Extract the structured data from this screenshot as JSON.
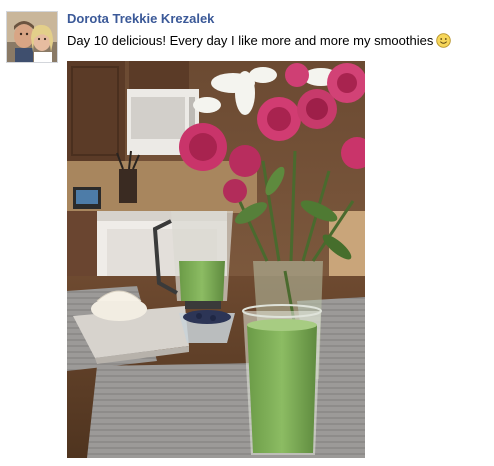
{
  "post": {
    "author_name": "Dorota Trekkie Krezalek",
    "message": "Day 10 delicious! Every day I like more and more my smoothies",
    "emoticon": "smiley-face-icon"
  },
  "colors": {
    "author_link": "#3b5998",
    "smoothie_green": "#7fae5a",
    "rose_pink": "#c9346a"
  }
}
